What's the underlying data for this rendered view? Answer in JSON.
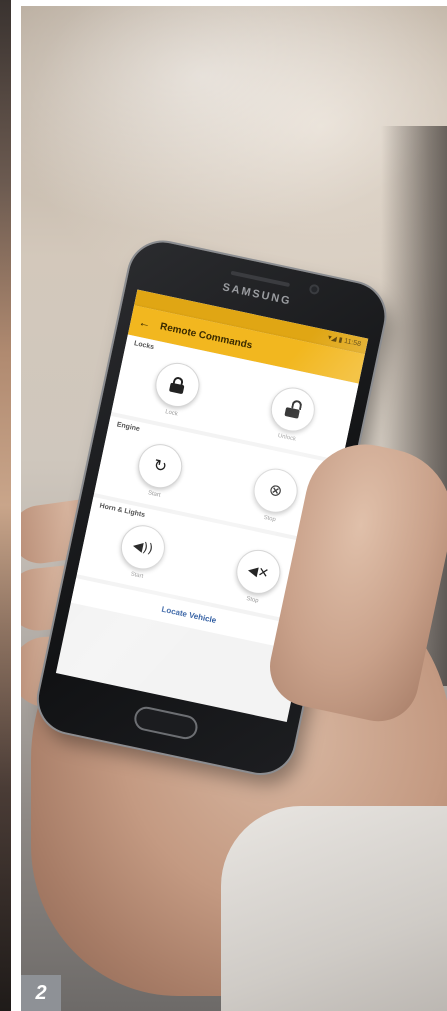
{
  "phone": {
    "brand": "SAMSUNG",
    "status_time": "▾◢ ▮ 11:58"
  },
  "app": {
    "title": "Remote Commands",
    "sections": [
      {
        "header": "Locks",
        "commands": [
          {
            "icon": "lock-icon",
            "label": "Lock"
          },
          {
            "icon": "unlock-icon",
            "label": "Unlock"
          }
        ]
      },
      {
        "header": "Engine",
        "commands": [
          {
            "icon": "engine-start-icon",
            "label": "Start"
          },
          {
            "icon": "engine-stop-icon",
            "label": "Stop"
          }
        ]
      },
      {
        "header": "Horn & Lights",
        "commands": [
          {
            "icon": "horn-icon",
            "label": "Start"
          },
          {
            "icon": "horn-stop-icon",
            "label": "Stop"
          }
        ]
      }
    ],
    "footer_link": "Locate Vehicle"
  },
  "page_number": "2",
  "colors": {
    "app_bar": "#f2b71f",
    "status_bar": "#e0a614",
    "badge": "#8e9196",
    "link": "#2c5aa0"
  }
}
